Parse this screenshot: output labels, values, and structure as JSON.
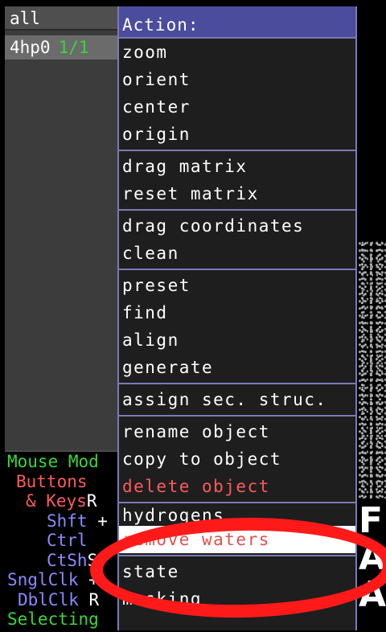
{
  "object_panel": {
    "all_label": "all",
    "object": {
      "name": "4hp0",
      "state": "1/1"
    }
  },
  "mouse_mode": {
    "title": "Mouse Mod",
    "buttons": "Buttons",
    "keys": "& Keys",
    "keys_suffix": "R",
    "shft": "Shft",
    "shft_suffix": "+",
    "ctrl": "Ctrl",
    "ctsh": "CtSh",
    "ctsh_suffix": "S",
    "sngl": "SnglClk",
    "sngl_suffix": "+",
    "dbl": "DblClk",
    "dbl_suffix": "R",
    "selecting": "Selecting"
  },
  "menu": {
    "header": "Action:",
    "groups": [
      [
        "zoom",
        "orient",
        "center",
        "origin"
      ],
      [
        "drag matrix",
        "reset matrix"
      ],
      [
        "drag coordinates",
        "clean"
      ],
      [
        "preset",
        "find",
        "align",
        "generate"
      ],
      [
        "assign sec. struc."
      ],
      [
        "rename object",
        "copy to object",
        "delete object"
      ],
      [
        "hydrogens",
        "remove waters"
      ],
      [
        "state",
        "masking"
      ]
    ]
  },
  "background_letters": "F\nA\nA",
  "colors": {
    "menu_header": "#4c4c9c",
    "menu_border": "#7a7ab8",
    "danger_text": "#ff5a5a",
    "state_green": "#3ad63a",
    "annotation": "#ff1a1a"
  }
}
